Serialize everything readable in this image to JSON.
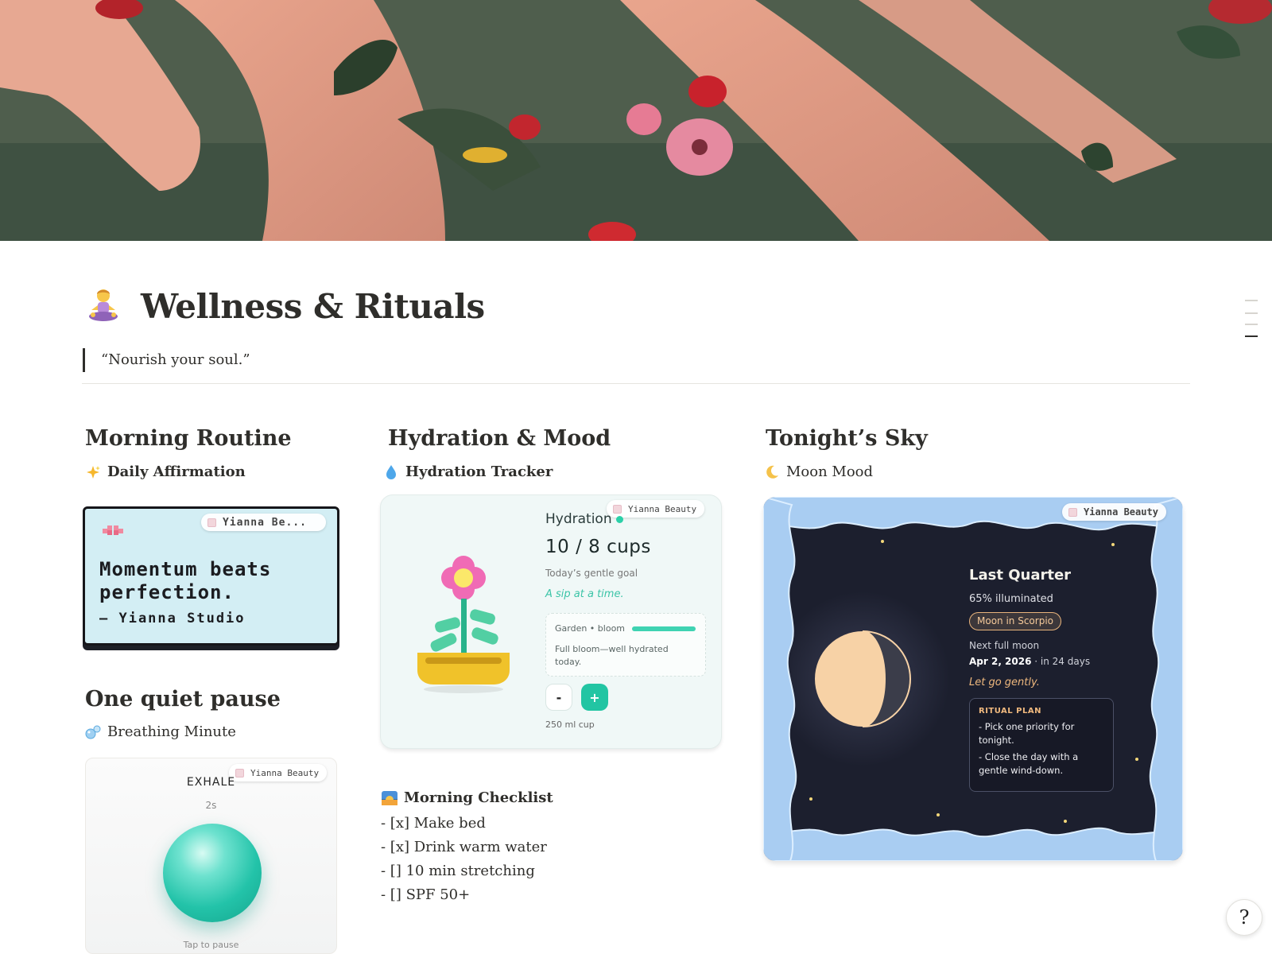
{
  "page": {
    "title": "Wellness & Rituals",
    "quote": "“Nourish your soul.”"
  },
  "sections": {
    "morning_routine": "Morning Routine",
    "one_quiet_pause": "One quiet pause",
    "hydration_mood": "Hydration & Mood",
    "tonights_sky": "Tonight’s Sky"
  },
  "subheadings": {
    "daily_affirmation": "Daily Affirmation",
    "breathing_minute": "Breathing Minute",
    "hydration_tracker": "Hydration Tracker",
    "moon_mood": "Moon Mood",
    "morning_checklist": "Morning Checklist"
  },
  "icons": {
    "page_icon": "person-in-lotus-icon",
    "affirmation": "sparkles-icon",
    "breathing": "bubbles-icon",
    "hydration": "droplet-icon",
    "moon": "crescent-moon-icon",
    "checklist": "sunrise-icon",
    "help": "help-icon"
  },
  "widgets": {
    "badge_full": "Yianna Beauty",
    "badge_truncated": "Yianna Be..."
  },
  "affirmation": {
    "line1": "Momentum beats",
    "line2": "perfection.",
    "author": "— Yianna Studio"
  },
  "breathing": {
    "phase": "EXHALE",
    "seconds": "2s",
    "hint": "Tap to pause"
  },
  "hydration": {
    "title": "Hydration",
    "cups": "10 / 8 cups",
    "goal": "Today’s gentle goal",
    "tagline": "A sip at a time.",
    "garden_label": "Garden • bloom",
    "garden_progress": 1.0,
    "garden_desc": "Full bloom—well hydrated today.",
    "minus": "-",
    "plus": "+",
    "cup_size": "250 ml cup"
  },
  "checklist": [
    "- [x] Make bed",
    "- [x] Drink warm water",
    "- [] 10 min stretching",
    "- [] SPF 50+"
  ],
  "moon": {
    "phase": "Last Quarter",
    "illumination": "65% illuminated",
    "sign": "Moon in Scorpio",
    "next_label": "Next full moon",
    "next_date": "Apr 2, 2026",
    "next_in": " · in 24 days",
    "mantra": "Let go gently.",
    "plan_title": "RITUAL PLAN",
    "plan_items": [
      "- Pick one priority for tonight.",
      "- Close the day with a gentle wind-down."
    ]
  },
  "colors": {
    "affirmation_bg": "#d3eef4",
    "hydration_accent": "#22c5a3",
    "moon_bg": "#1c1f2e",
    "moon_accent": "#f0b97e"
  }
}
